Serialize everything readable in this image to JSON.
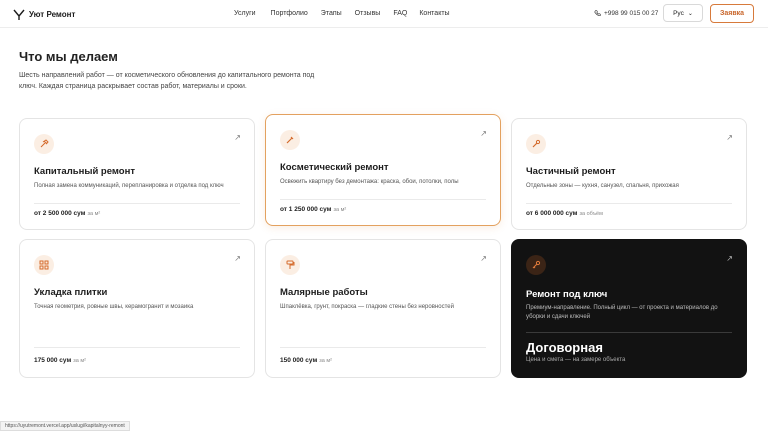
{
  "header": {
    "brand": "Уют Ремонт",
    "nav": [
      "Услуги",
      "Портфолио",
      "Этапы",
      "Отзывы",
      "FAQ",
      "Контакты"
    ],
    "phone": "+998 99 015 00 27",
    "lang": "Рус",
    "cta": "Заявка"
  },
  "section": {
    "title": "Что мы делаем",
    "desc": "Шесть направлений работ — от косметического обновления до капитального ремонта под ключ. Каждая страница раскрывает состав работ, материалы и сроки."
  },
  "cards": [
    {
      "icon": "hammer-icon",
      "title": "Капитальный ремонт",
      "desc": "Полная замена коммуникаций, перепланировка и отделка под ключ",
      "price": "от 2 500 000 сум",
      "unit": "за м²"
    },
    {
      "icon": "brush-icon",
      "title": "Косметический ремонт",
      "desc": "Освежить квартиру без демонтажа: краска, обои, потолки, полы",
      "price": "от 1 250 000 сум",
      "unit": "за м²"
    },
    {
      "icon": "wrench-icon",
      "title": "Частичный ремонт",
      "desc": "Отдельные зоны — кухня, санузел, спальня, прихожая",
      "price": "от 6 000 000 сум",
      "unit": "за объём"
    },
    {
      "icon": "tiles-icon",
      "title": "Укладка плитки",
      "desc": "Точная геометрия, ровные швы, керамогранит и мозаика",
      "price": "175 000 сум",
      "unit": "за м²"
    },
    {
      "icon": "paint-roller-icon",
      "title": "Малярные работы",
      "desc": "Шпаклёвка, грунт, покраска — гладкие стены без неровностей",
      "price": "150 000 сум",
      "unit": "за м²"
    },
    {
      "icon": "key-icon",
      "title": "Ремонт под ключ",
      "desc": "Премиум-направление. Полный цикл — от проекта и материалов до уборки и сдачи ключей",
      "big": "Договорная",
      "note": "Цена и смета — на замере объекта"
    }
  ],
  "status_url": "https://uyutremont.vercel.app/uslugi/kapitalnyy-remont"
}
